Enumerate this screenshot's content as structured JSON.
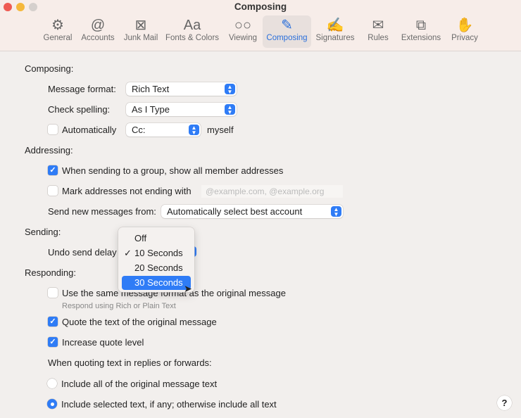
{
  "window": {
    "title": "Composing"
  },
  "toolbar": [
    {
      "label": "General",
      "icon": "⚙"
    },
    {
      "label": "Accounts",
      "icon": "@"
    },
    {
      "label": "Junk Mail",
      "icon": "⊠"
    },
    {
      "label": "Fonts & Colors",
      "icon": "Aa"
    },
    {
      "label": "Viewing",
      "icon": "○○"
    },
    {
      "label": "Composing",
      "icon": "✎"
    },
    {
      "label": "Signatures",
      "icon": "✍"
    },
    {
      "label": "Rules",
      "icon": "✉"
    },
    {
      "label": "Extensions",
      "icon": "⧉"
    },
    {
      "label": "Privacy",
      "icon": "✋"
    }
  ],
  "composing": {
    "heading": "Composing:",
    "message_format_label": "Message format:",
    "message_format": "Rich Text",
    "check_spelling_label": "Check spelling:",
    "check_spelling": "As I Type",
    "automatically_label": "Automatically",
    "automatically_value": "Cc:",
    "myself": "myself"
  },
  "addressing": {
    "heading": "Addressing:",
    "group_label": "When sending to a group, show all member addresses",
    "mark_label": "Mark addresses not ending with",
    "mark_placeholder": "@example.com, @example.org",
    "send_from_label": "Send new messages from:",
    "send_from": "Automatically select best account"
  },
  "sending": {
    "heading": "Sending:",
    "undo_label": "Undo send delay",
    "options": [
      "Off",
      "10 Seconds",
      "20 Seconds",
      "30 Seconds"
    ],
    "checked": "✓"
  },
  "responding": {
    "heading": "Responding:",
    "same_format": "Use the same message format as the original message",
    "same_format_sub": "Respond using Rich or Plain Text",
    "quote": "Quote the text of the original message",
    "increase": "Increase quote level",
    "when_quoting": "When quoting text in replies or forwards:",
    "include_all": "Include all of the original message text",
    "include_selected": "Include selected text, if any; otherwise include all text"
  },
  "help": "?"
}
